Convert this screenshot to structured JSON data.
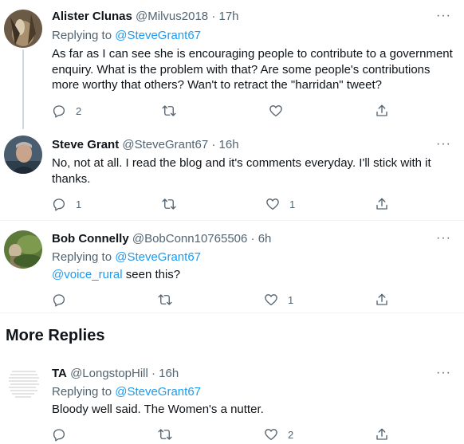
{
  "colors": {
    "accent": "#1d9bf0",
    "muted": "#536471",
    "text": "#0f1419",
    "divider": "#eff3f4"
  },
  "tweets": [
    {
      "name": "Alister Clunas",
      "handle": "@Milvus2018",
      "time": "· 17h",
      "replying_prefix": "Replying to ",
      "replying_handle": "@SteveGrant67",
      "text": "As far as I can see she is encouraging people to contribute to a government enquiry. What is the problem with that? Are some people's contributions more worthy that others? Wan't to retract the \"harridan\" tweet?",
      "reply_count": "2",
      "retweet_count": "",
      "like_count": ""
    },
    {
      "name": "Steve Grant",
      "handle": "@SteveGrant67",
      "time": "· 16h",
      "text": "No, not at all. I read the blog and it's comments everyday. I'll stick with it thanks.",
      "reply_count": "1",
      "retweet_count": "",
      "like_count": "1"
    },
    {
      "name": "Bob Connelly",
      "handle": "@BobConn10765506",
      "time": "· 6h",
      "replying_prefix": "Replying to ",
      "replying_handle": "@SteveGrant67",
      "mention": "@voice_rural",
      "text_rest": " seen this?",
      "reply_count": "",
      "retweet_count": "",
      "like_count": "1"
    },
    {
      "name": "TA",
      "handle": "@LongstopHill",
      "time": "· 16h",
      "replying_prefix": "Replying to ",
      "replying_handle": "@SteveGrant67",
      "text": "Bloody well said. The Women's a nutter.",
      "reply_count": "",
      "retweet_count": "",
      "like_count": "2"
    }
  ],
  "more_replies_title": "More Replies",
  "more_icon_glyph": "···",
  "icons": [
    "reply-icon",
    "retweet-icon",
    "like-icon",
    "share-icon",
    "more-options-icon"
  ]
}
